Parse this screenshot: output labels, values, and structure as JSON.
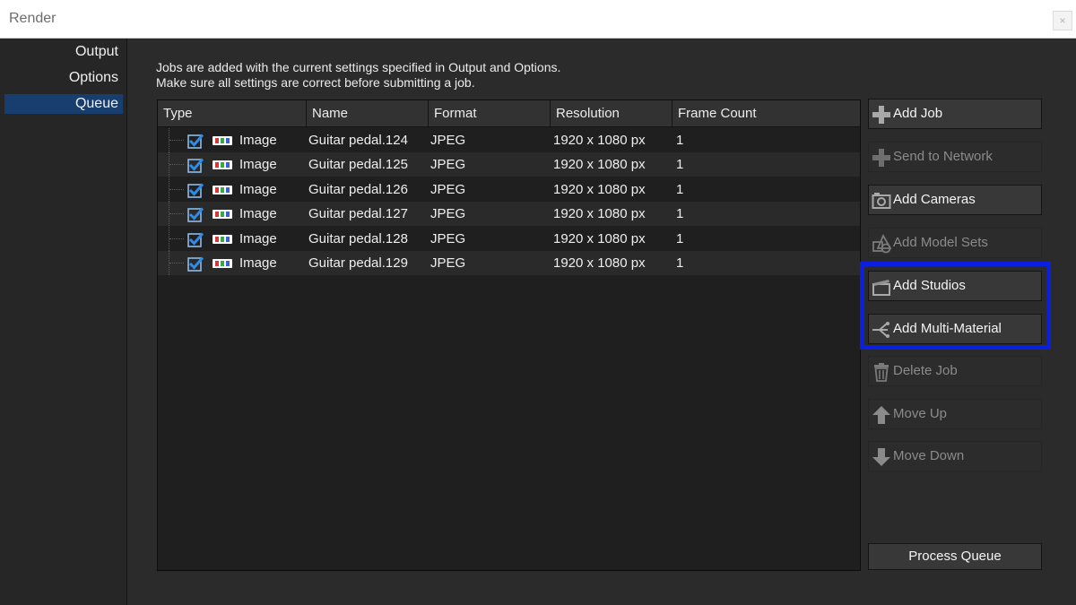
{
  "window": {
    "title": "Render",
    "close_glyph": "×"
  },
  "sidebar": {
    "items": [
      "Output",
      "Options",
      "Queue"
    ],
    "active": "Queue"
  },
  "info": {
    "line1": "Jobs are added with the current settings specified in Output and Options.",
    "line2": "Make sure all settings are correct before submitting a job."
  },
  "table": {
    "columns": [
      "Type",
      "Name",
      "Format",
      "Resolution",
      "Frame Count"
    ],
    "rows": [
      {
        "type": "Image",
        "name": "Guitar pedal.124",
        "format": "JPEG",
        "resolution": "1920 x 1080 px",
        "frames": "1",
        "checked": true
      },
      {
        "type": "Image",
        "name": "Guitar pedal.125",
        "format": "JPEG",
        "resolution": "1920 x 1080 px",
        "frames": "1",
        "checked": true
      },
      {
        "type": "Image",
        "name": "Guitar pedal.126",
        "format": "JPEG",
        "resolution": "1920 x 1080 px",
        "frames": "1",
        "checked": true
      },
      {
        "type": "Image",
        "name": "Guitar pedal.127",
        "format": "JPEG",
        "resolution": "1920 x 1080 px",
        "frames": "1",
        "checked": true
      },
      {
        "type": "Image",
        "name": "Guitar pedal.128",
        "format": "JPEG",
        "resolution": "1920 x 1080 px",
        "frames": "1",
        "checked": true
      },
      {
        "type": "Image",
        "name": "Guitar pedal.129",
        "format": "JPEG",
        "resolution": "1920 x 1080 px",
        "frames": "1",
        "checked": true
      }
    ]
  },
  "buttons": {
    "add_job": {
      "label": "Add Job",
      "icon": "plus-icon",
      "enabled": true
    },
    "send_to_network": {
      "label": "Send to Network",
      "icon": "plus-icon",
      "enabled": false
    },
    "add_cameras": {
      "label": "Add Cameras",
      "icon": "camera-icon",
      "enabled": true
    },
    "add_model_sets": {
      "label": "Add Model Sets",
      "icon": "shapes-icon",
      "enabled": false
    },
    "add_studios": {
      "label": "Add Studios",
      "icon": "clapperboard-icon",
      "enabled": true
    },
    "add_multi_material": {
      "label": "Add Multi-Material",
      "icon": "branch-icon",
      "enabled": true
    },
    "delete_job": {
      "label": "Delete Job",
      "icon": "trash-icon",
      "enabled": false
    },
    "move_up": {
      "label": "Move Up",
      "icon": "arrow-up-icon",
      "enabled": false
    },
    "move_down": {
      "label": "Move Down",
      "icon": "arrow-down-icon",
      "enabled": false
    },
    "process_queue": {
      "label": "Process Queue",
      "enabled": true
    }
  },
  "colors": {
    "accent_selected": "#173e6f",
    "highlight_box": "#0a1fe0",
    "checkbox_blue": "#2e8be6",
    "image_icon_red": "#d23a3a",
    "image_icon_green": "#3aa64a",
    "image_icon_blue": "#3a63d2"
  }
}
